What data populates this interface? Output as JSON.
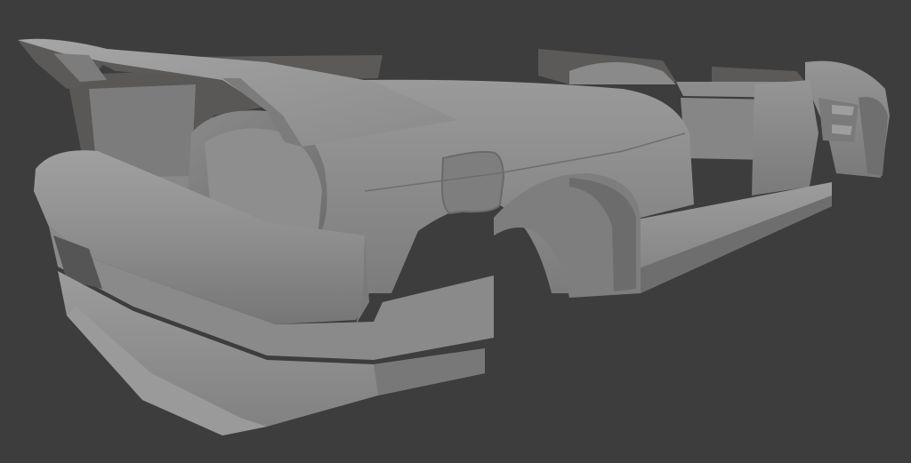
{
  "viewport": {
    "background_color": "#3d3d3d",
    "model_color": "#8f8f8f",
    "shadow_color": "#5a5858"
  }
}
